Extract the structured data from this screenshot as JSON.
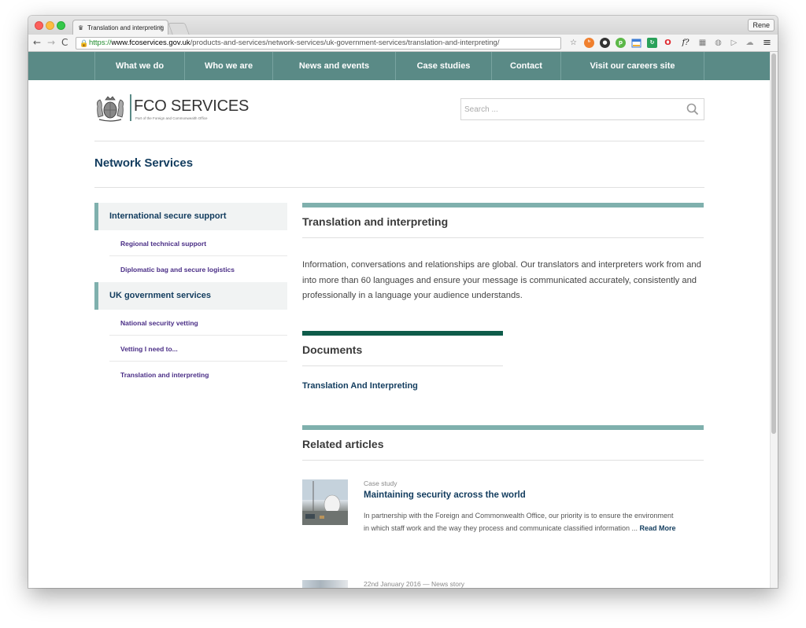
{
  "browser": {
    "tab_title": "Translation and interpreting",
    "tab_close": "×",
    "profile_name": "Rene",
    "url": {
      "protocol": "https://",
      "host": "www.fcoservices.gov.uk",
      "path": "/products-and-services/network-services/uk-government-services/translation-and-interpreting/"
    },
    "nav": {
      "back": "←",
      "forward": "→",
      "reload": "C"
    },
    "extensions": [
      "star-icon",
      "extension-orange-icon",
      "extension-dark-icon",
      "extension-green-pin-icon",
      "extension-calendar-icon",
      "extension-refresh-icon",
      "opera-icon",
      "font-f-icon",
      "extension-grey-icon",
      "extension-grey-icon",
      "play-icon",
      "cloud-icon",
      "menu-icon"
    ],
    "extension_glyphs": {
      "star": "☆",
      "ff": "f?",
      "menu": "≡",
      "play": "▷"
    }
  },
  "site": {
    "nav": [
      "What we do",
      "Who we are",
      "News and events",
      "Case studies",
      "Contact",
      "Visit our careers site"
    ],
    "logo": {
      "name": "FCO SERVICES",
      "subtitle": "Part of the Foreign and Commonwealth Office"
    },
    "search_placeholder": "Search ...",
    "section_title": "Network Services"
  },
  "sidebar": {
    "groups": [
      {
        "label": "International secure support",
        "items": [
          "Regional technical support",
          "Diplomatic bag and secure logistics"
        ]
      },
      {
        "label": "UK government services",
        "items": [
          "National security vetting",
          "Vetting I need to...",
          "Translation and interpreting"
        ]
      }
    ]
  },
  "main": {
    "title": "Translation and interpreting",
    "body": "Information, conversations and relationships are global. Our translators and interpreters work from and into more than 60 languages and ensure your message is communicated accurately, consistently and professionally in a language your audience understands.",
    "documents_heading": "Documents",
    "document_link": "Translation And Interpreting",
    "related_heading": "Related articles",
    "articles": [
      {
        "kicker": "Case study",
        "title": "Maintaining security across the world",
        "excerpt": "In partnership with the Foreign and Commonwealth Office, our priority is to ensure the environment in which staff work and the way they process and communicate classified information ...",
        "read_more": "Read More"
      },
      {
        "kicker": "22nd January 2016 — News story"
      }
    ]
  },
  "colors": {
    "nav_bg": "#5a8a86",
    "accent_teal": "#7fb0ad",
    "accent_dark_green": "#0e5c4a",
    "link_navy": "#123c5e",
    "sub_link_purple": "#4a2e86"
  }
}
